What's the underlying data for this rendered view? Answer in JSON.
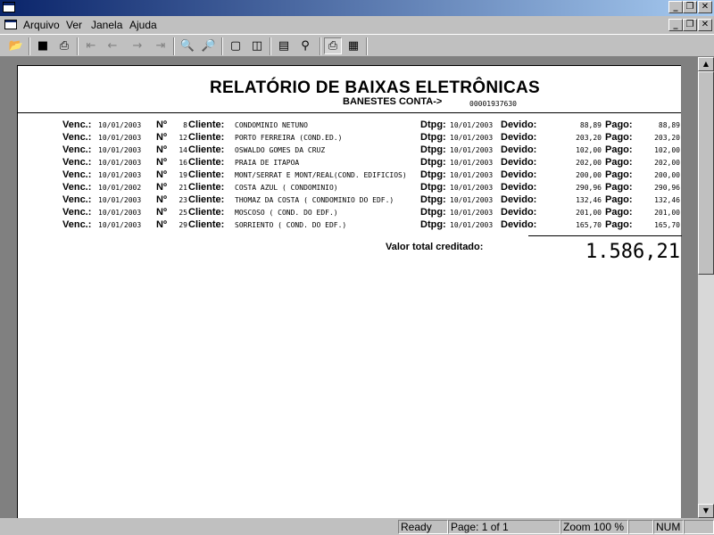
{
  "menu": {
    "file": "Arquivo",
    "view": "Ver",
    "window": "Janela",
    "help": "Ajuda"
  },
  "toolbar": {
    "icons": [
      "open-icon",
      "save-icon",
      "print-icon",
      "first-page-icon",
      "prev-page-icon",
      "next-page-icon",
      "last-page-icon",
      "zoom-in-icon",
      "zoom-out-icon",
      "one-page-icon",
      "two-page-icon",
      "page-setup-icon",
      "find-icon",
      "print-preview-icon",
      "export-icon"
    ]
  },
  "report": {
    "title": "RELATÓRIO DE BAIXAS ELETRÔNICAS",
    "subtitle": "BANESTES CONTA->",
    "account": "00001937630",
    "labels": {
      "venc": "Venc.:",
      "no": "Nº",
      "cliente": "Cliente:",
      "dtpg": "Dtpg:",
      "devido": "Devido:",
      "pago": "Pago:"
    },
    "rows": [
      {
        "venc": "10/01/2003",
        "no": "8",
        "cliente": "CONDOMINIO NETUNO",
        "dtpg": "10/01/2003",
        "devido": "88,89",
        "pago": "88,89"
      },
      {
        "venc": "10/01/2003",
        "no": "12",
        "cliente": "PORTO FERREIRA (COND.ED.)",
        "dtpg": "10/01/2003",
        "devido": "203,20",
        "pago": "203,20"
      },
      {
        "venc": "10/01/2003",
        "no": "14",
        "cliente": "OSWALDO GOMES DA CRUZ",
        "dtpg": "10/01/2003",
        "devido": "102,00",
        "pago": "102,00"
      },
      {
        "venc": "10/01/2003",
        "no": "16",
        "cliente": "PRAIA DE ITAPOA",
        "dtpg": "10/01/2003",
        "devido": "202,00",
        "pago": "202,00"
      },
      {
        "venc": "10/01/2003",
        "no": "19",
        "cliente": "MONT/SERRAT E MONT/REAL(COND. EDIFICIOS)",
        "dtpg": "10/01/2003",
        "devido": "200,00",
        "pago": "200,00"
      },
      {
        "venc": "10/01/2002",
        "no": "21",
        "cliente": "COSTA AZUL ( CONDOMINIO)",
        "dtpg": "10/01/2003",
        "devido": "290,96",
        "pago": "290,96"
      },
      {
        "venc": "10/01/2003",
        "no": "23",
        "cliente": "THOMAZ DA COSTA ( CONDOMINIO DO EDF.)",
        "dtpg": "10/01/2003",
        "devido": "132,46",
        "pago": "132,46"
      },
      {
        "venc": "10/01/2003",
        "no": "25",
        "cliente": "MOSCOSO ( COND. DO EDF.)",
        "dtpg": "10/01/2003",
        "devido": "201,00",
        "pago": "201,00"
      },
      {
        "venc": "10/01/2003",
        "no": "29",
        "cliente": "SORRIENTO ( COND. DO EDF.)",
        "dtpg": "10/01/2003",
        "devido": "165,70",
        "pago": "165,70"
      }
    ],
    "total_label": "Valor total creditado:",
    "total_value": "1.586,21"
  },
  "status": {
    "state": "Ready",
    "page": "Page: 1 of 1",
    "zoom": "Zoom 100 %",
    "num": "NUM"
  }
}
